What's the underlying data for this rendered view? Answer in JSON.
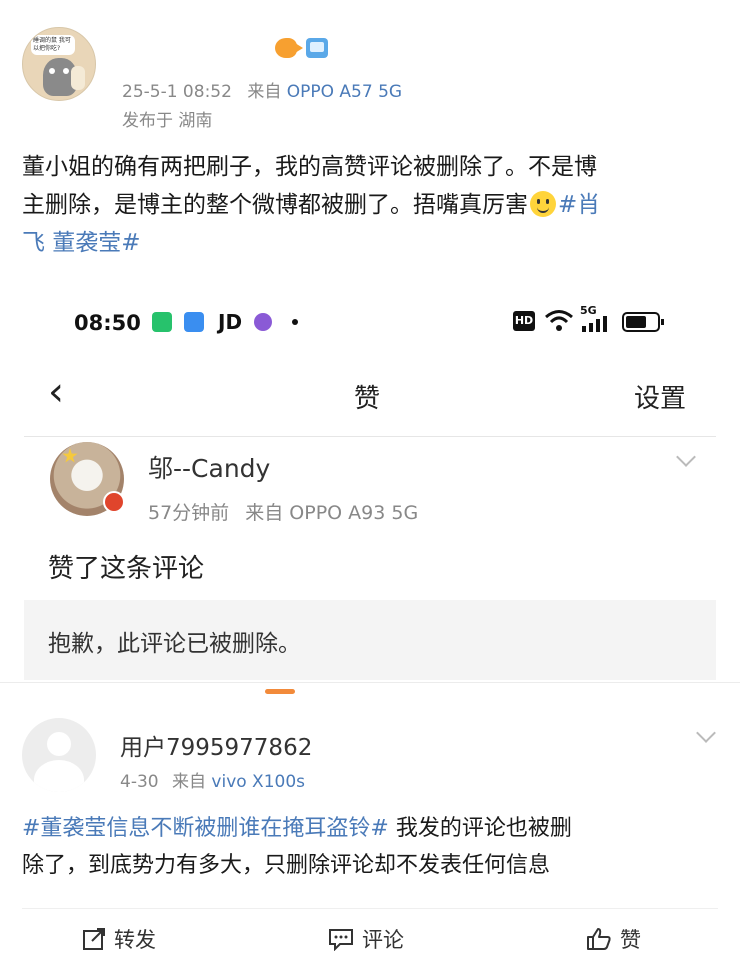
{
  "post1": {
    "time": "25-5-1 08:52",
    "source_prefix": "来自",
    "device": "OPPO A57 5G",
    "location": "发布于 湖南",
    "text_line1": "董小姐的确有两把刷子，我的高赞评论被删除了。不是博",
    "text_line2_part1": "主删除，是博主的整个微博都被删了。捂嘴真厉害",
    "text_line2_topic": "#肖",
    "text_line3_topic": "飞 董袭莹#",
    "avatar_bubble": "睡调的鼠 我可以把你吃?"
  },
  "screenshot": {
    "status_time": "08:50",
    "status_jd": "JD",
    "status_hd": "HD",
    "status_5g": "5G",
    "nav_back": "‹",
    "nav_title": "赞",
    "nav_right": "设置",
    "user_name": "邬--Candy",
    "user_time": "57分钟前",
    "user_source_prefix": "来自",
    "user_device": "OPPO A93 5G",
    "action_text": "赞了这条评论",
    "deleted_text": "抱歉，此评论已被删除。"
  },
  "comment": {
    "user_name": "用户7995977862",
    "date": "4-30",
    "source_prefix": "来自",
    "device": "vivo X100s",
    "topic": "#董袭莹信息不断被删谁在掩耳盗铃#",
    "text_part1": " 我发的评论也被删",
    "text_line2": "除了，到底势力有多大，只删除评论却不发表任何信息"
  },
  "actions": {
    "repost": "转发",
    "comment": "评论",
    "like": "赞"
  },
  "colors": {
    "link_blue": "#4a7ab8",
    "meta_gray": "#888888",
    "handle_orange": "#f28a3a"
  }
}
